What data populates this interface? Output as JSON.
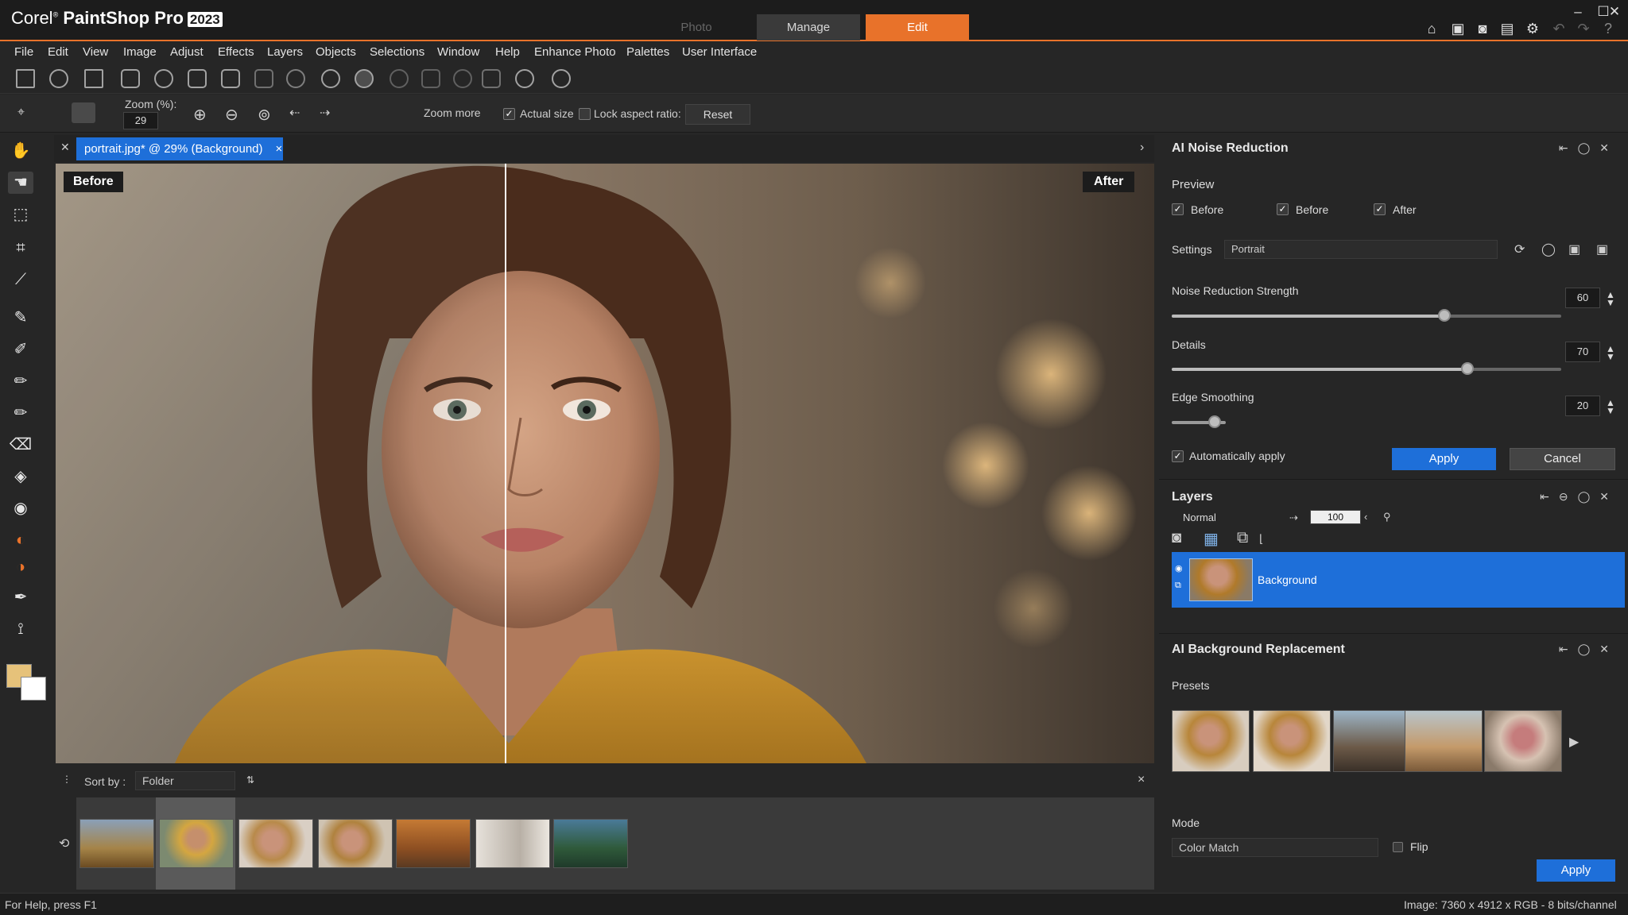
{
  "app": {
    "brand_prefix": "Corel",
    "brand_name": "PaintShop Pro",
    "brand_year": "2023"
  },
  "workspace_tabs": {
    "photo": "Photo",
    "manage": "Manage",
    "edit": "Edit"
  },
  "menu": [
    "File",
    "Edit",
    "View",
    "Image",
    "Adjust",
    "Effects",
    "Layers",
    "Objects",
    "Selections",
    "Window",
    "Help",
    "Enhance Photo",
    "Palettes",
    "User Interface"
  ],
  "tool_options": {
    "zoom_label": "Zoom (%):",
    "zoom_value": "29",
    "zoom_more_label": "Zoom more",
    "actual_size_label": "Actual size",
    "lock_aspect_label": "Lock aspect ratio:",
    "reset_label": "Reset"
  },
  "document": {
    "tab_label": "portrait.jpg* @ 29% (Background)",
    "close_glyph": "×"
  },
  "compare": {
    "before_label": "Before",
    "after_label": "After",
    "split_fraction": 0.409
  },
  "filmstrip": {
    "sort_label": "Sort by :",
    "sort_value": "Folder",
    "close_glyph": "×"
  },
  "status": {
    "help": "For Help, press F1",
    "image_info": "Image: 7360 x 4912 x RGB - 8 bits/channel"
  },
  "noise_panel": {
    "title": "AI Noise Reduction",
    "preview_label": "Preview",
    "checks": [
      {
        "label": "Before",
        "checked": true
      },
      {
        "label": "Before",
        "checked": true
      },
      {
        "label": "After",
        "checked": true
      }
    ],
    "settings_label": "Settings",
    "settings_value": "Portrait",
    "sliders": [
      {
        "label": "Noise Reduction Strength",
        "value": "60",
        "fraction": 0.7
      },
      {
        "label": "Details",
        "value": "70",
        "fraction": 0.76
      },
      {
        "label": "Edge Smoothing",
        "value": "20",
        "fraction": 0.11
      }
    ],
    "auto_apply_label": "Automatically apply",
    "apply_label": "Apply",
    "cancel_label": "Cancel"
  },
  "layers_panel": {
    "title": "Layers",
    "blend_mode": "Normal",
    "opacity": "100",
    "layer_name": "Background"
  },
  "bg_panel": {
    "title": "AI Background Replacement",
    "presets_label": "Presets",
    "mode_label": "Mode",
    "mode_value": "Color Match",
    "flip_label": "Flip",
    "apply_label": "Apply"
  }
}
